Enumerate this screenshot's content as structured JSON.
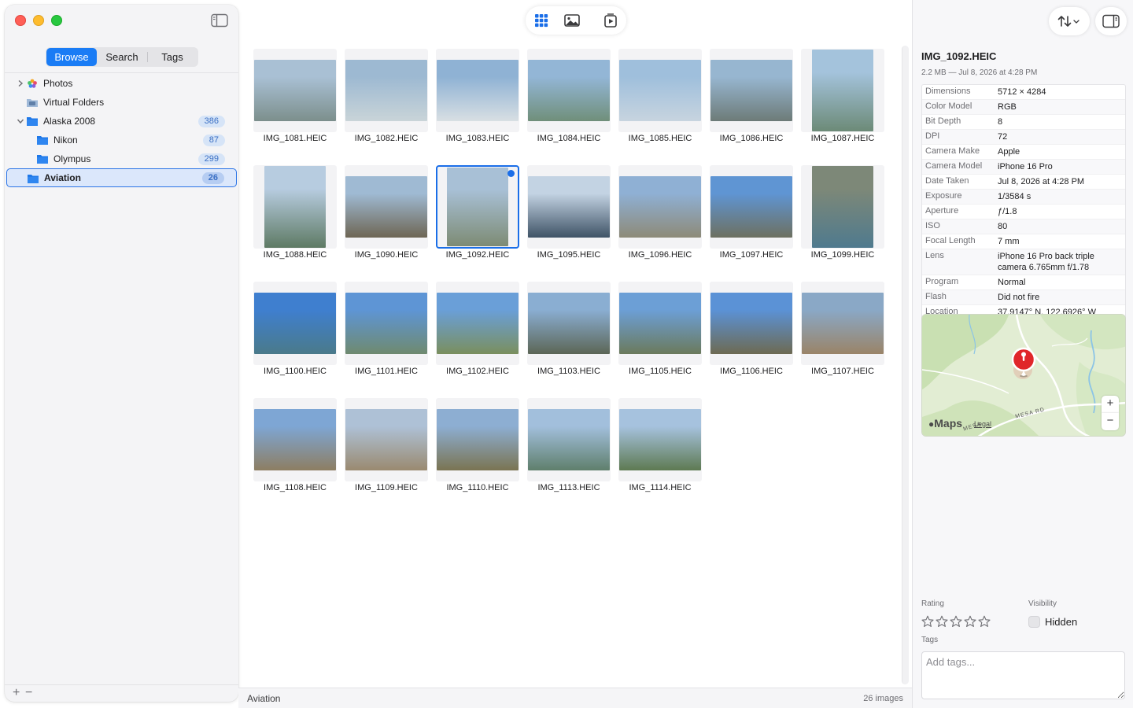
{
  "sidebar": {
    "segments": [
      "Browse",
      "Search",
      "Tags"
    ],
    "items": [
      {
        "label": "Photos",
        "badge": "",
        "icon": "photos-icon",
        "level": 0,
        "chevron": "right"
      },
      {
        "label": "Virtual Folders",
        "badge": "",
        "icon": "virtual-folder-icon",
        "level": 0,
        "chevron": ""
      },
      {
        "label": "Alaska 2008",
        "badge": "386",
        "icon": "folder-icon",
        "level": 0,
        "chevron": "down"
      },
      {
        "label": "Nikon",
        "badge": "87",
        "icon": "folder-icon",
        "level": 1,
        "chevron": ""
      },
      {
        "label": "Olympus",
        "badge": "299",
        "icon": "folder-icon",
        "level": 1,
        "chevron": ""
      },
      {
        "label": "Aviation",
        "badge": "26",
        "icon": "folder-icon",
        "level": 0,
        "chevron": "",
        "selected": true
      }
    ],
    "footer_add": "+",
    "footer_remove": "−"
  },
  "toolbar": {
    "icons": [
      "grid-view-icon",
      "photo-view-icon",
      "slideshow-icon"
    ]
  },
  "images": [
    {
      "name": "IMG_1081.HEIC",
      "orient": "landscape",
      "c1": "#a9c0d4",
      "c2": "#7c8f8c"
    },
    {
      "name": "IMG_1082.HEIC",
      "orient": "landscape",
      "c1": "#9db9d2",
      "c2": "#c9d4d8"
    },
    {
      "name": "IMG_1083.HEIC",
      "orient": "landscape",
      "c1": "#8fb2d4",
      "c2": "#d8dfe3"
    },
    {
      "name": "IMG_1084.HEIC",
      "orient": "landscape",
      "c1": "#93b6d6",
      "c2": "#708f7a"
    },
    {
      "name": "IMG_1085.HEIC",
      "orient": "landscape",
      "c1": "#9fbfdc",
      "c2": "#c7d4df"
    },
    {
      "name": "IMG_1086.HEIC",
      "orient": "landscape",
      "c1": "#97b6d0",
      "c2": "#6d7b78"
    },
    {
      "name": "IMG_1087.HEIC",
      "orient": "portrait",
      "c1": "#a4c3dc",
      "c2": "#6c8a77"
    },
    {
      "name": "IMG_1088.HEIC",
      "orient": "portrait",
      "c1": "#b7cce0",
      "c2": "#5e7a64"
    },
    {
      "name": "IMG_1090.HEIC",
      "orient": "landscape",
      "c1": "#9fbad3",
      "c2": "#6e6654"
    },
    {
      "name": "IMG_1092.HEIC",
      "orient": "portrait",
      "c1": "#a8c0d6",
      "c2": "#7d8b74",
      "selected": true
    },
    {
      "name": "IMG_1095.HEIC",
      "orient": "landscape",
      "c1": "#c3d3e3",
      "c2": "#3f5366"
    },
    {
      "name": "IMG_1096.HEIC",
      "orient": "landscape",
      "c1": "#8fb0d4",
      "c2": "#8d8a78"
    },
    {
      "name": "IMG_1097.HEIC",
      "orient": "landscape",
      "c1": "#5f95d3",
      "c2": "#6d7060"
    },
    {
      "name": "IMG_1099.HEIC",
      "orient": "portrait",
      "c1": "#7d8878",
      "c2": "#4f7a8e"
    },
    {
      "name": "IMG_1100.HEIC",
      "orient": "landscape",
      "c1": "#3f7fcf",
      "c2": "#4a7a8a"
    },
    {
      "name": "IMG_1101.HEIC",
      "orient": "landscape",
      "c1": "#5e95d5",
      "c2": "#6f8a6f"
    },
    {
      "name": "IMG_1102.HEIC",
      "orient": "landscape",
      "c1": "#6a9fd8",
      "c2": "#7a8f5e"
    },
    {
      "name": "IMG_1103.HEIC",
      "orient": "landscape",
      "c1": "#8aaed2",
      "c2": "#5c6656"
    },
    {
      "name": "IMG_1105.HEIC",
      "orient": "landscape",
      "c1": "#6c9fd6",
      "c2": "#6b7a5c"
    },
    {
      "name": "IMG_1106.HEIC",
      "orient": "landscape",
      "c1": "#5b92d6",
      "c2": "#6d6a52"
    },
    {
      "name": "IMG_1107.HEIC",
      "orient": "landscape",
      "c1": "#8aa8c6",
      "c2": "#9a8468"
    },
    {
      "name": "IMG_1108.HEIC",
      "orient": "landscape",
      "c1": "#7ea6d4",
      "c2": "#8d7e62"
    },
    {
      "name": "IMG_1109.HEIC",
      "orient": "landscape",
      "c1": "#aec1d6",
      "c2": "#9a8a70"
    },
    {
      "name": "IMG_1110.HEIC",
      "orient": "landscape",
      "c1": "#8daed2",
      "c2": "#7a7452"
    },
    {
      "name": "IMG_1113.HEIC",
      "orient": "landscape",
      "c1": "#a2bfdc",
      "c2": "#5f7f6c"
    },
    {
      "name": "IMG_1114.HEIC",
      "orient": "landscape",
      "c1": "#a6c2de",
      "c2": "#5e7a52"
    }
  ],
  "status": {
    "folder": "Aviation",
    "count": "26 images"
  },
  "inspector": {
    "title": "IMG_1092.HEIC",
    "subtitle": "2.2 MB — Jul 8, 2026 at 4:28 PM",
    "metadata": [
      {
        "key": "Dimensions",
        "value": "5712 × 4284"
      },
      {
        "key": "Color Model",
        "value": "RGB"
      },
      {
        "key": "Bit Depth",
        "value": "8"
      },
      {
        "key": "DPI",
        "value": "72"
      },
      {
        "key": "Camera Make",
        "value": "Apple"
      },
      {
        "key": "Camera Model",
        "value": "iPhone 16 Pro"
      },
      {
        "key": "Date Taken",
        "value": "Jul 8, 2026 at 4:28 PM"
      },
      {
        "key": "Exposure",
        "value": "1/3584 s"
      },
      {
        "key": "Aperture",
        "value": "ƒ/1.8"
      },
      {
        "key": "ISO",
        "value": "80"
      },
      {
        "key": "Focal Length",
        "value": "7 mm"
      },
      {
        "key": "Lens",
        "value": "iPhone 16 Pro back triple camera 6.765mm f/1.78"
      },
      {
        "key": "Program",
        "value": "Normal"
      },
      {
        "key": "Flash",
        "value": "Did not fire"
      },
      {
        "key": "Location",
        "value": "37.9147° N, 122.6926° W"
      }
    ],
    "map": {
      "logo": "Maps",
      "legal": "Legal",
      "road1": "MESA RD",
      "road2": "MESA",
      "zoom_in": "+",
      "zoom_out": "−"
    },
    "rating_label": "Rating",
    "rating_value": 0,
    "rating_max": 5,
    "visibility_label": "Visibility",
    "hidden_label": "Hidden",
    "hidden_checked": false,
    "tags_label": "Tags",
    "tags_placeholder": "Add tags..."
  },
  "colors": {
    "accent": "#1a7cf5",
    "selection_border": "#2b74e6",
    "badge_bg": "#d6e4f7",
    "map_pin": "#e0262a"
  }
}
